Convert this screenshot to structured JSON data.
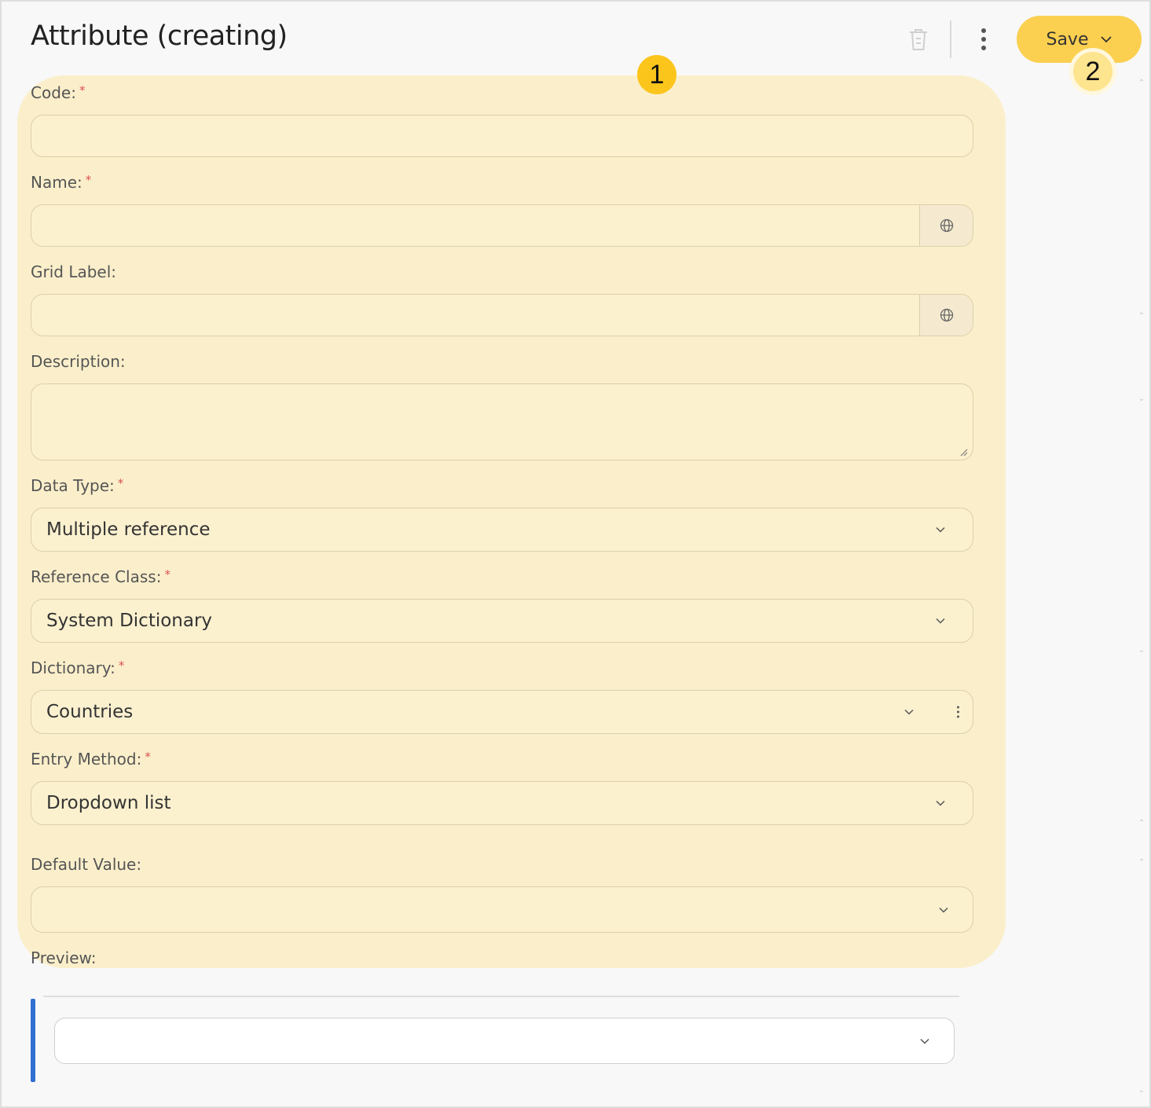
{
  "header": {
    "title": "Attribute (creating)",
    "save_label": "Save"
  },
  "badges": [
    "1",
    "2"
  ],
  "form": {
    "code": {
      "label": "Code:",
      "required": "*",
      "value": ""
    },
    "name": {
      "label": "Name:",
      "required": "*",
      "value": ""
    },
    "grid_label": {
      "label": "Grid Label:",
      "value": ""
    },
    "description": {
      "label": "Description:",
      "value": ""
    },
    "data_type": {
      "label": "Data Type:",
      "required": "*",
      "value": "Multiple reference"
    },
    "reference_class": {
      "label": "Reference Class:",
      "required": "*",
      "value": "System Dictionary"
    },
    "dictionary": {
      "label": "Dictionary:",
      "required": "*",
      "value": "Countries"
    },
    "entry_method": {
      "label": "Entry Method:",
      "required": "*",
      "value": "Dropdown list"
    },
    "default_value": {
      "label": "Default Value:",
      "value": ""
    },
    "preview": {
      "label": "Preview:",
      "value": ""
    }
  },
  "colors": {
    "accent": "#fbd050",
    "highlight": "#fbefcb",
    "badge": "#fbc51c",
    "required": "#d9534f",
    "preview_bar": "#2f6fd1"
  },
  "icons": [
    "trash-icon",
    "kebab-menu-icon",
    "chevron-down-icon",
    "globe-icon",
    "resize-handle-icon"
  ]
}
